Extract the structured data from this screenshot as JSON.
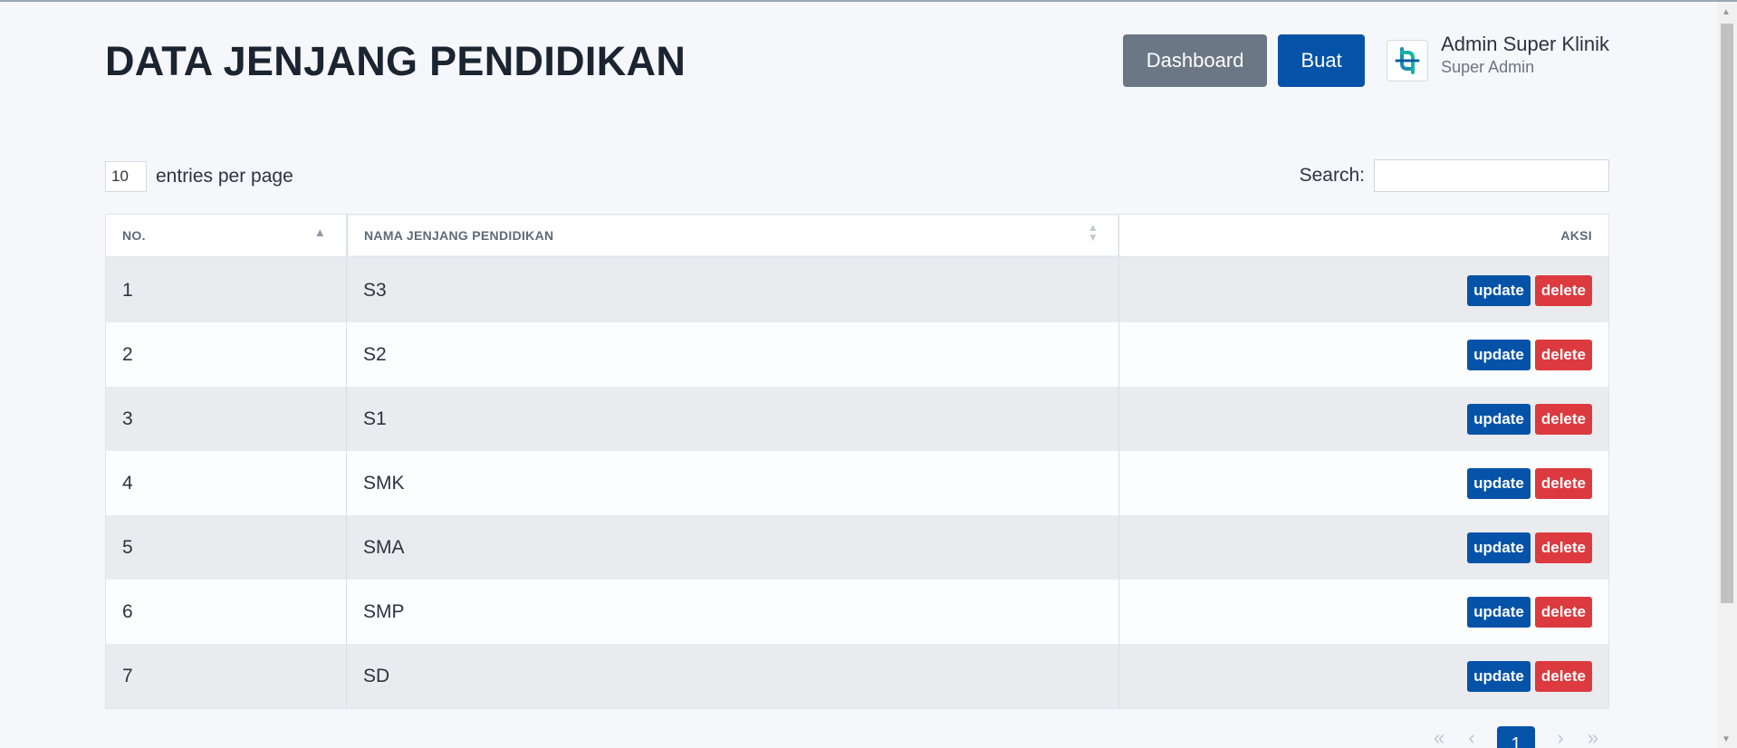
{
  "header": {
    "title": "DATA JENJANG PENDIDIKAN",
    "dashboard_label": "Dashboard",
    "create_label": "Buat",
    "user_name": "Admin Super Klinik",
    "user_role": "Super Admin"
  },
  "controls": {
    "entries_value": "10",
    "entries_label": "entries per page",
    "search_label": "Search:",
    "search_value": ""
  },
  "table": {
    "columns": [
      "NO.",
      "NAMA JENJANG PENDIDIKAN",
      "AKSI"
    ],
    "rows": [
      {
        "no": "1",
        "name": "S3"
      },
      {
        "no": "2",
        "name": "S2"
      },
      {
        "no": "3",
        "name": "S1"
      },
      {
        "no": "4",
        "name": "SMK"
      },
      {
        "no": "5",
        "name": "SMA"
      },
      {
        "no": "6",
        "name": "SMP"
      },
      {
        "no": "7",
        "name": "SD"
      }
    ],
    "update_label": "update",
    "delete_label": "delete"
  },
  "pagination": {
    "first": "«",
    "prev": "‹",
    "current": "1",
    "next": "›",
    "last": "»"
  },
  "colors": {
    "primary": "#0553a8",
    "secondary": "#6b7785",
    "danger": "#dc3a3f"
  }
}
